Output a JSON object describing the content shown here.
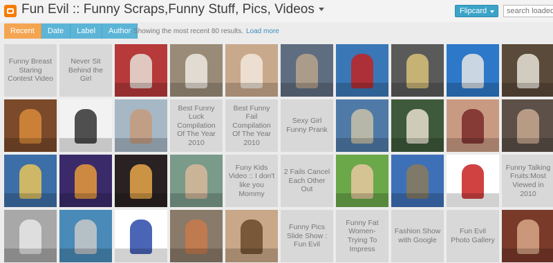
{
  "header": {
    "blog_title": "Fun Evil :: Funny Scraps,Funny Stuff, Pics, Videos",
    "view_button": "Flipcard",
    "search_placeholder": "search loaded posts"
  },
  "tabs": [
    {
      "label": "Recent",
      "active": true
    },
    {
      "label": "Date",
      "active": false
    },
    {
      "label": "Label",
      "active": false
    },
    {
      "label": "Author",
      "active": false
    }
  ],
  "results_text": "Showing the most recent 80 results.",
  "load_more": "Load more",
  "posts": [
    {
      "type": "text",
      "title": "Funny Breast Staring Contest Video"
    },
    {
      "type": "text",
      "title": "Never Sit Behind the Girl"
    },
    {
      "type": "image",
      "name": "dancer-thumbnail",
      "bg": "#b63a3a",
      "accent": "#e8e0d8"
    },
    {
      "type": "image",
      "name": "book-reader-thumbnail",
      "bg": "#9a8b78",
      "accent": "#efe9e0"
    },
    {
      "type": "image",
      "name": "couple-photo-thumbnail",
      "bg": "#c9a98c",
      "accent": "#f2e8dc"
    },
    {
      "type": "image",
      "name": "cat-costume-thumbnail",
      "bg": "#5f6d80",
      "accent": "#b8a58c"
    },
    {
      "type": "image",
      "name": "red-dragon-thumbnail",
      "bg": "#3a77b6",
      "accent": "#c22222"
    },
    {
      "type": "image",
      "name": "photo-frame-thumbnail",
      "bg": "#5a5a5a",
      "accent": "#d9c27a"
    },
    {
      "type": "image",
      "name": "surfboards-thumbnail",
      "bg": "#2d78c9",
      "accent": "#e6e6e6"
    },
    {
      "type": "image",
      "name": "statues-thumbnail",
      "bg": "#5a4a3a",
      "accent": "#e8e2d8"
    },
    {
      "type": "image",
      "name": "band-photo-thumbnail",
      "bg": "#7a4a2a",
      "accent": "#d88a3a"
    },
    {
      "type": "image",
      "name": "cats-collage-thumbnail",
      "bg": "#f2f2f2",
      "accent": "#333333"
    },
    {
      "type": "image",
      "name": "beach-people-thumbnail",
      "bg": "#a6b8c6",
      "accent": "#c59a7a"
    },
    {
      "type": "text",
      "title": "Best Funny Luck Compilation Of The Year 2010"
    },
    {
      "type": "text",
      "title": "Best Funny Fail Compilation Of The Year 2010"
    },
    {
      "type": "text",
      "title": "Sexy Girl Funny Prank"
    },
    {
      "type": "image",
      "name": "punk-bird-thumbnail",
      "bg": "#4f7aa8",
      "accent": "#c8c2a8"
    },
    {
      "type": "image",
      "name": "dog-photo-thumbnail",
      "bg": "#3e5a3a",
      "accent": "#e8e0d0"
    },
    {
      "type": "image",
      "name": "tattoo-thumbnail",
      "bg": "#c99a82",
      "accent": "#7a2a2a"
    },
    {
      "type": "image",
      "name": "portrait-thumbnail",
      "bg": "#5c5048",
      "accent": "#c8a890"
    },
    {
      "type": "image",
      "name": "face-painting-thumbnail",
      "bg": "#3c6ea8",
      "accent": "#e8c45a"
    },
    {
      "type": "image",
      "name": "king-cat-thumbnail",
      "bg": "#3a2a6a",
      "accent": "#e89a3a"
    },
    {
      "type": "image",
      "name": "palace-night-thumbnail",
      "bg": "#2a2222",
      "accent": "#e8a84a"
    },
    {
      "type": "image",
      "name": "kid-drinking-thumbnail",
      "bg": "#7a9a8a",
      "accent": "#d8b89a"
    },
    {
      "type": "text",
      "title": "Funy Kids Video :: I don't like you Mommy"
    },
    {
      "type": "text",
      "title": "2 Fails Cancel Each Other Out"
    },
    {
      "type": "image",
      "name": "hula-hoop-girl-thumbnail",
      "bg": "#6aa84a",
      "accent": "#e8c8a0"
    },
    {
      "type": "image",
      "name": "tree-climb-thumbnail",
      "bg": "#3e70b8",
      "accent": "#8a7a5a"
    },
    {
      "type": "image",
      "name": "comic-strip-thumbnail",
      "bg": "#ffffff",
      "accent": "#c82020"
    },
    {
      "type": "text",
      "title": "Funny Talking Fruits:Most Viewed in 2010"
    },
    {
      "type": "image",
      "name": "cat-bottle-thumbnail",
      "bg": "#a8a8a8",
      "accent": "#e8e8e8"
    },
    {
      "type": "image",
      "name": "robot-woman-thumbnail",
      "bg": "#4a8ab8",
      "accent": "#c8c8c8"
    },
    {
      "type": "image",
      "name": "list-menu-thumbnail",
      "bg": "#ffffff",
      "accent": "#2a4aa8"
    },
    {
      "type": "image",
      "name": "couple-statue-thumbnail",
      "bg": "#8a7a6a",
      "accent": "#c87a4a"
    },
    {
      "type": "image",
      "name": "vintage-man-thumbnail",
      "bg": "#c8a888",
      "accent": "#6a4a2a"
    },
    {
      "type": "text",
      "title": "Funny Pics Slide Show : Fun Evil"
    },
    {
      "type": "text",
      "title": "Funny Fat Women-Trying To Impress"
    },
    {
      "type": "text",
      "title": "Fashion Show with Google"
    },
    {
      "type": "text",
      "title": "Fun Evil Photo Gallery"
    },
    {
      "type": "image",
      "name": "actress-thumbnail",
      "bg": "#7a3a2a",
      "accent": "#d8a888"
    }
  ]
}
